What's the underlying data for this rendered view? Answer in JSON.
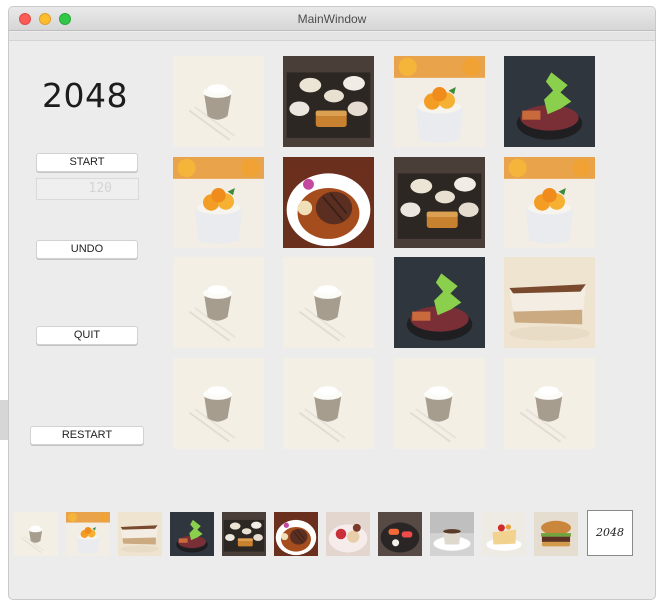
{
  "window": {
    "title": "MainWindow"
  },
  "game": {
    "title": "2048",
    "score_display": "120"
  },
  "buttons": {
    "start": "START",
    "undo": "UNDO",
    "quit": "QUIT",
    "restart": "RESTART"
  },
  "board": {
    "rows": [
      [
        "rice-bowl",
        "tonkatsu-set",
        "mango-dessert",
        "matcha-parfait"
      ],
      [
        "mango-dessert",
        "steak-plate",
        "tonkatsu-set",
        "mango-dessert"
      ],
      [
        "rice-bowl",
        "rice-bowl",
        "matcha-parfait",
        "tiramisu-slice"
      ],
      [
        "rice-bowl",
        "rice-bowl",
        "rice-bowl",
        "rice-bowl"
      ]
    ]
  },
  "tile_legend": [
    "rice-bowl",
    "mango-dessert",
    "tiramisu-slice",
    "matcha-parfait",
    "tonkatsu-set",
    "steak-plate",
    "dessert-platter",
    "sushi-plate",
    "pudding-cup",
    "cake-slice",
    "burger"
  ],
  "logo": {
    "label": "2048"
  }
}
